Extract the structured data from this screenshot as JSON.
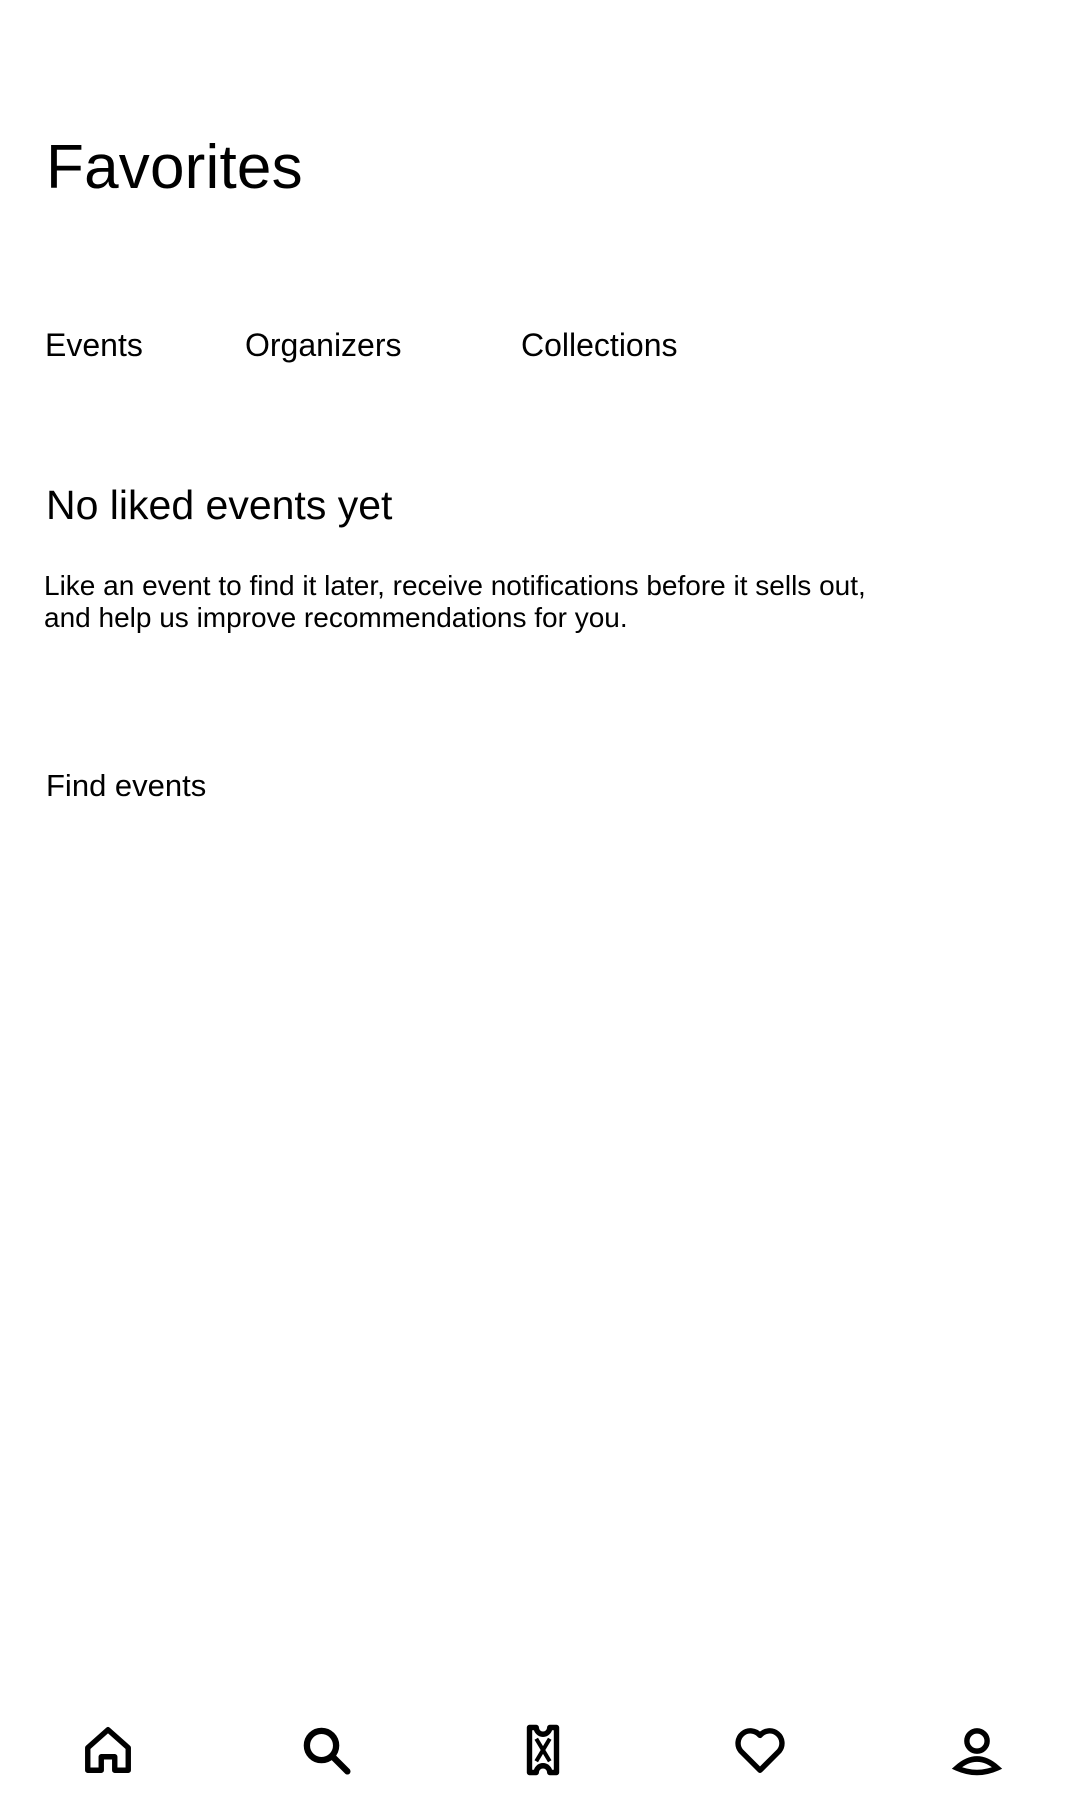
{
  "header": {
    "title": "Favorites"
  },
  "tabs": [
    {
      "label": "Events"
    },
    {
      "label": "Organizers"
    },
    {
      "label": "Collections"
    }
  ],
  "empty_state": {
    "title": "No liked events yet",
    "description": "Like an event to find it later, receive notifications before it sells out, and help us improve recommendations for you.",
    "action_label": "Find events"
  },
  "bottom_nav": {
    "items": [
      {
        "icon": "home-icon"
      },
      {
        "icon": "search-icon"
      },
      {
        "icon": "ticket-icon"
      },
      {
        "icon": "heart-icon"
      },
      {
        "icon": "profile-icon"
      }
    ]
  },
  "colors": {
    "background": "#ffffff",
    "text": "#000000"
  }
}
